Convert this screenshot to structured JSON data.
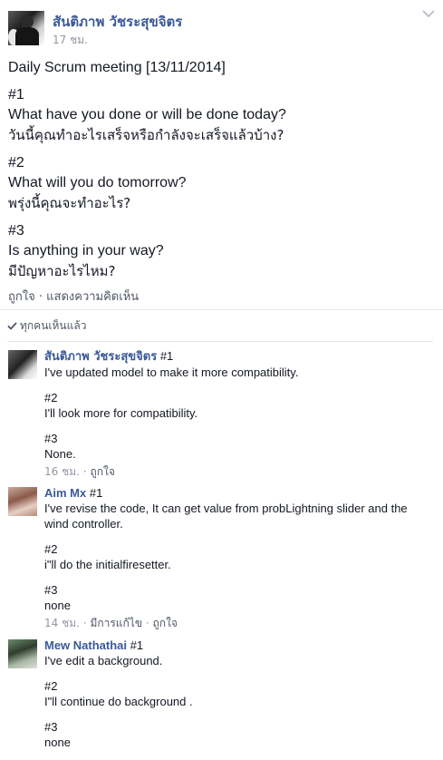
{
  "post": {
    "author": "สันติภาพ วัชระสุขจิตร",
    "time": "17 ชม.",
    "lines": [
      "Daily Scrum meeting [13/11/2014]",
      "#1",
      "What have you done or will be done today?",
      "วันนี้คุณทำอะไรเสร็จหรือกำลังจะเสร็จแล้วบ้าง?",
      "#2",
      "What will you do tomorrow?",
      "พรุ่งนี้คุณจะทำอะไร?",
      "#3",
      "Is anything in your way?",
      "มีปัญหาอะไรไหม?"
    ],
    "like_label": "ถูกใจ",
    "separator": "·",
    "comment_label": "แสดงความคิดเห็น",
    "seen_label": "ทุกคนเห็นแล้ว"
  },
  "comments": [
    {
      "author": "สันติภาพ วัชระสุขจิตร",
      "first_line": "#1",
      "line1": "I've updated model to make it more compatibility.",
      "h2": "#2",
      "line2": "I'll look more for compatibility.",
      "h3": "#3",
      "line3": "None.",
      "time": "16 ชม.",
      "sep": "·",
      "like": "ถูกใจ"
    },
    {
      "author": "Aim Mx",
      "first_line": "#1",
      "line1": "I've revise the code, It can get value from probLightning slider and the wind controller.",
      "h2": "#2",
      "line2": "i\"ll do the initialfiresetter.",
      "h3": "#3",
      "line3": "none",
      "time": "14 ชม.",
      "sep": "·",
      "edited": "มีการแก้ไข",
      "sep2": "·",
      "like": "ถูกใจ"
    },
    {
      "author": "Mew Nathathai",
      "first_line": "#1",
      "line1": "I've edit a background.",
      "h2": "#2",
      "line2": "I\"ll continue do background .",
      "h3": "#3",
      "line3": "none"
    }
  ],
  "colors": {
    "link": "#3b5998",
    "meta": "#9197a3",
    "text": "#141823"
  }
}
